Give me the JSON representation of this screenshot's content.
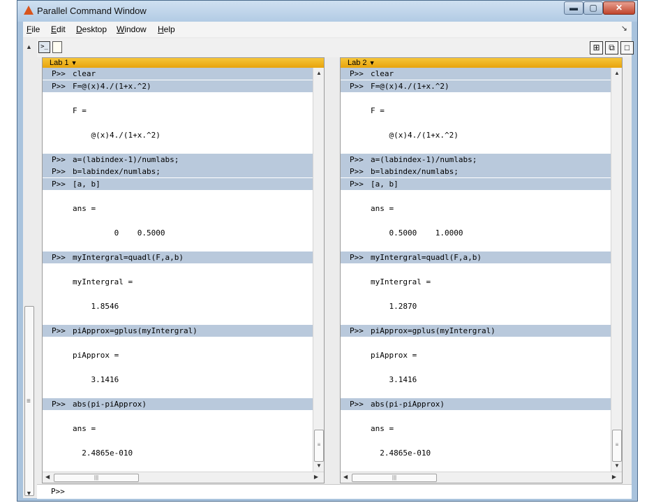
{
  "window": {
    "title": "Parallel Command Window"
  },
  "menu": {
    "file": "File",
    "edit": "Edit",
    "desktop": "Desktop",
    "window": "Window",
    "help": "Help"
  },
  "toolbar": {
    "cmd_icon_glyph": ">_"
  },
  "labs": [
    {
      "label": "Lab 1",
      "lines": [
        {
          "kind": "cmd",
          "prompt": "P>>",
          "text": "clear"
        },
        {
          "kind": "cmd",
          "prompt": "P>>",
          "text": "F=@(x)4./(1+x.^2)"
        },
        {
          "kind": "out",
          "text": ""
        },
        {
          "kind": "out",
          "text": "F ="
        },
        {
          "kind": "out",
          "text": ""
        },
        {
          "kind": "out",
          "text": "    @(x)4./(1+x.^2)"
        },
        {
          "kind": "out",
          "text": ""
        },
        {
          "kind": "cmd",
          "prompt": "P>>",
          "text": "a=(labindex-1)/numlabs;"
        },
        {
          "kind": "cmd",
          "prompt": "P>>",
          "text": "b=labindex/numlabs;"
        },
        {
          "kind": "cmd",
          "prompt": "P>>",
          "text": "[a, b]"
        },
        {
          "kind": "out",
          "text": ""
        },
        {
          "kind": "out",
          "text": "ans ="
        },
        {
          "kind": "out",
          "text": ""
        },
        {
          "kind": "out",
          "text": "         0    0.5000"
        },
        {
          "kind": "out",
          "text": ""
        },
        {
          "kind": "cmd",
          "prompt": "P>>",
          "text": "myIntergral=quadl(F,a,b)"
        },
        {
          "kind": "out",
          "text": ""
        },
        {
          "kind": "out",
          "text": "myIntergral ="
        },
        {
          "kind": "out",
          "text": ""
        },
        {
          "kind": "out",
          "text": "    1.8546"
        },
        {
          "kind": "out",
          "text": ""
        },
        {
          "kind": "cmd",
          "prompt": "P>>",
          "text": "piApprox=gplus(myIntergral)"
        },
        {
          "kind": "out",
          "text": ""
        },
        {
          "kind": "out",
          "text": "piApprox ="
        },
        {
          "kind": "out",
          "text": ""
        },
        {
          "kind": "out",
          "text": "    3.1416"
        },
        {
          "kind": "out",
          "text": ""
        },
        {
          "kind": "cmd",
          "prompt": "P>>",
          "text": "abs(pi-piApprox)"
        },
        {
          "kind": "out",
          "text": ""
        },
        {
          "kind": "out",
          "text": "ans ="
        },
        {
          "kind": "out",
          "text": ""
        },
        {
          "kind": "out",
          "text": "  2.4865e-010"
        }
      ]
    },
    {
      "label": "Lab 2",
      "lines": [
        {
          "kind": "cmd",
          "prompt": "P>>",
          "text": "clear"
        },
        {
          "kind": "cmd",
          "prompt": "P>>",
          "text": "F=@(x)4./(1+x.^2)"
        },
        {
          "kind": "out",
          "text": ""
        },
        {
          "kind": "out",
          "text": "F ="
        },
        {
          "kind": "out",
          "text": ""
        },
        {
          "kind": "out",
          "text": "    @(x)4./(1+x.^2)"
        },
        {
          "kind": "out",
          "text": ""
        },
        {
          "kind": "cmd",
          "prompt": "P>>",
          "text": "a=(labindex-1)/numlabs;"
        },
        {
          "kind": "cmd",
          "prompt": "P>>",
          "text": "b=labindex/numlabs;"
        },
        {
          "kind": "cmd",
          "prompt": "P>>",
          "text": "[a, b]"
        },
        {
          "kind": "out",
          "text": ""
        },
        {
          "kind": "out",
          "text": "ans ="
        },
        {
          "kind": "out",
          "text": ""
        },
        {
          "kind": "out",
          "text": "    0.5000    1.0000"
        },
        {
          "kind": "out",
          "text": ""
        },
        {
          "kind": "cmd",
          "prompt": "P>>",
          "text": "myIntergral=quadl(F,a,b)"
        },
        {
          "kind": "out",
          "text": ""
        },
        {
          "kind": "out",
          "text": "myIntergral ="
        },
        {
          "kind": "out",
          "text": ""
        },
        {
          "kind": "out",
          "text": "    1.2870"
        },
        {
          "kind": "out",
          "text": ""
        },
        {
          "kind": "cmd",
          "prompt": "P>>",
          "text": "piApprox=gplus(myIntergral)"
        },
        {
          "kind": "out",
          "text": ""
        },
        {
          "kind": "out",
          "text": "piApprox ="
        },
        {
          "kind": "out",
          "text": ""
        },
        {
          "kind": "out",
          "text": "    3.1416"
        },
        {
          "kind": "out",
          "text": ""
        },
        {
          "kind": "cmd",
          "prompt": "P>>",
          "text": "abs(pi-piApprox)"
        },
        {
          "kind": "out",
          "text": ""
        },
        {
          "kind": "out",
          "text": "ans ="
        },
        {
          "kind": "out",
          "text": ""
        },
        {
          "kind": "out",
          "text": "  2.4865e-010"
        }
      ]
    }
  ],
  "prompt": "P>>"
}
